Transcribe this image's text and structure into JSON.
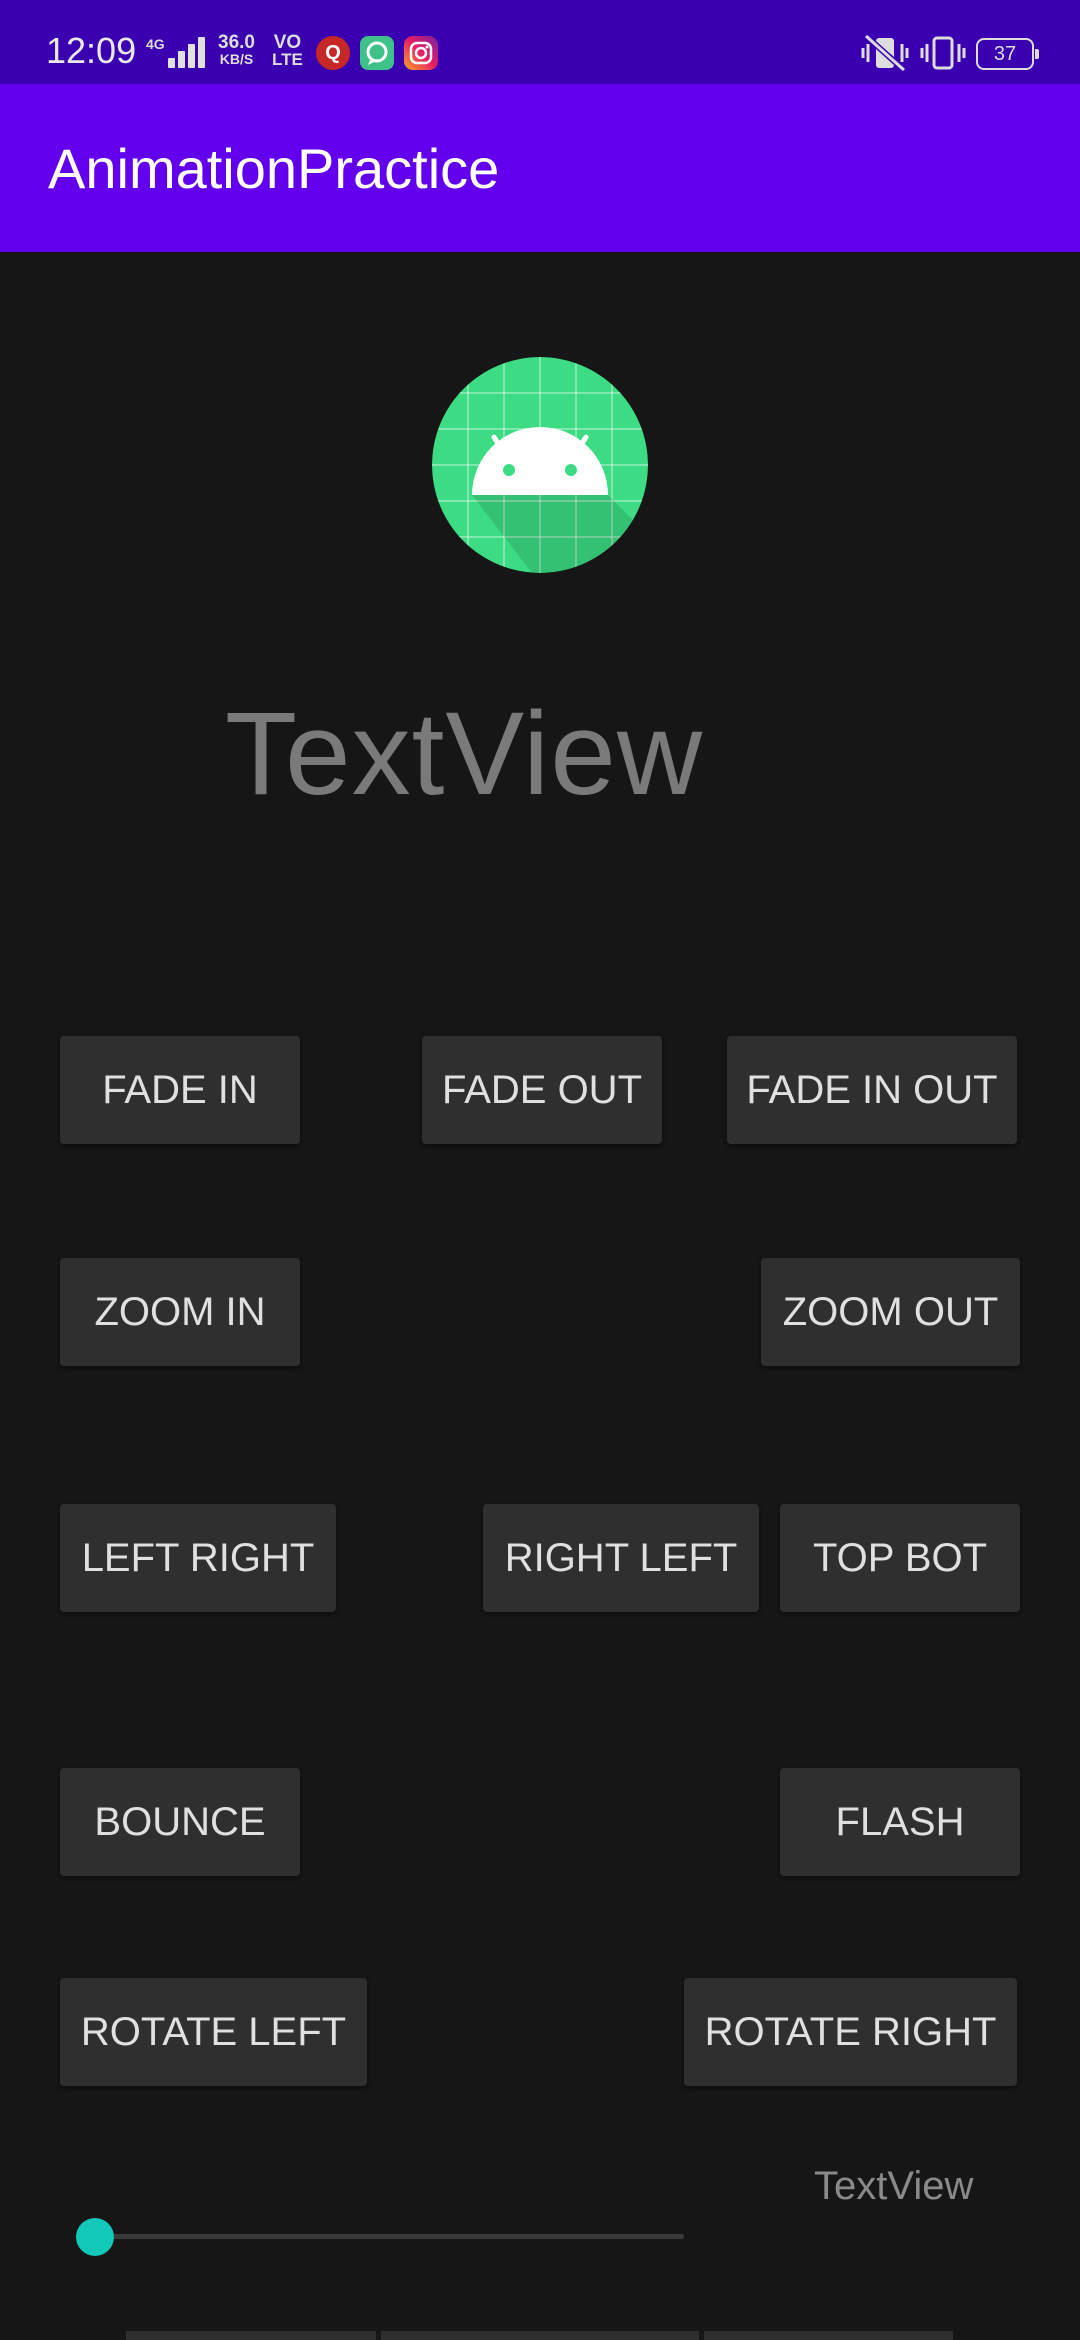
{
  "status_bar": {
    "time": "12:09",
    "network": "4G",
    "speed_value": "36.0",
    "speed_unit": "KB/S",
    "volte_top": "VO",
    "volte_bottom": "LTE",
    "battery": "37",
    "icons": [
      "signal-bars-icon",
      "quora-icon",
      "messaging-app-icon",
      "instagram-icon",
      "vibrate-mute-icon",
      "vibrate-icon",
      "battery-icon"
    ]
  },
  "app_bar": {
    "title": "AnimationPractice"
  },
  "logo": {
    "icon": "android-icon",
    "color": "#3ddc84"
  },
  "main": {
    "textview_large": "TextView",
    "textview_small": "TextView",
    "buttons": {
      "fade_in": "FADE IN",
      "fade_out": "FADE OUT",
      "fade_in_out": "FADE IN OUT",
      "zoom_in": "ZOOM IN",
      "zoom_out": "ZOOM OUT",
      "left_right": "LEFT RIGHT",
      "right_left": "RIGHT LEFT",
      "top_bot": "TOP BOT",
      "bounce": "BOUNCE",
      "flash": "FLASH",
      "rotate_left": "ROTATE LEFT",
      "rotate_right": "ROTATE RIGHT"
    },
    "seekbar": {
      "progress": 0,
      "accent_color": "#12c8b8"
    }
  },
  "colors": {
    "status_bar": "#3a00b0",
    "app_bar": "#6200ee",
    "background": "#161616",
    "button": "#2f2f2f"
  }
}
